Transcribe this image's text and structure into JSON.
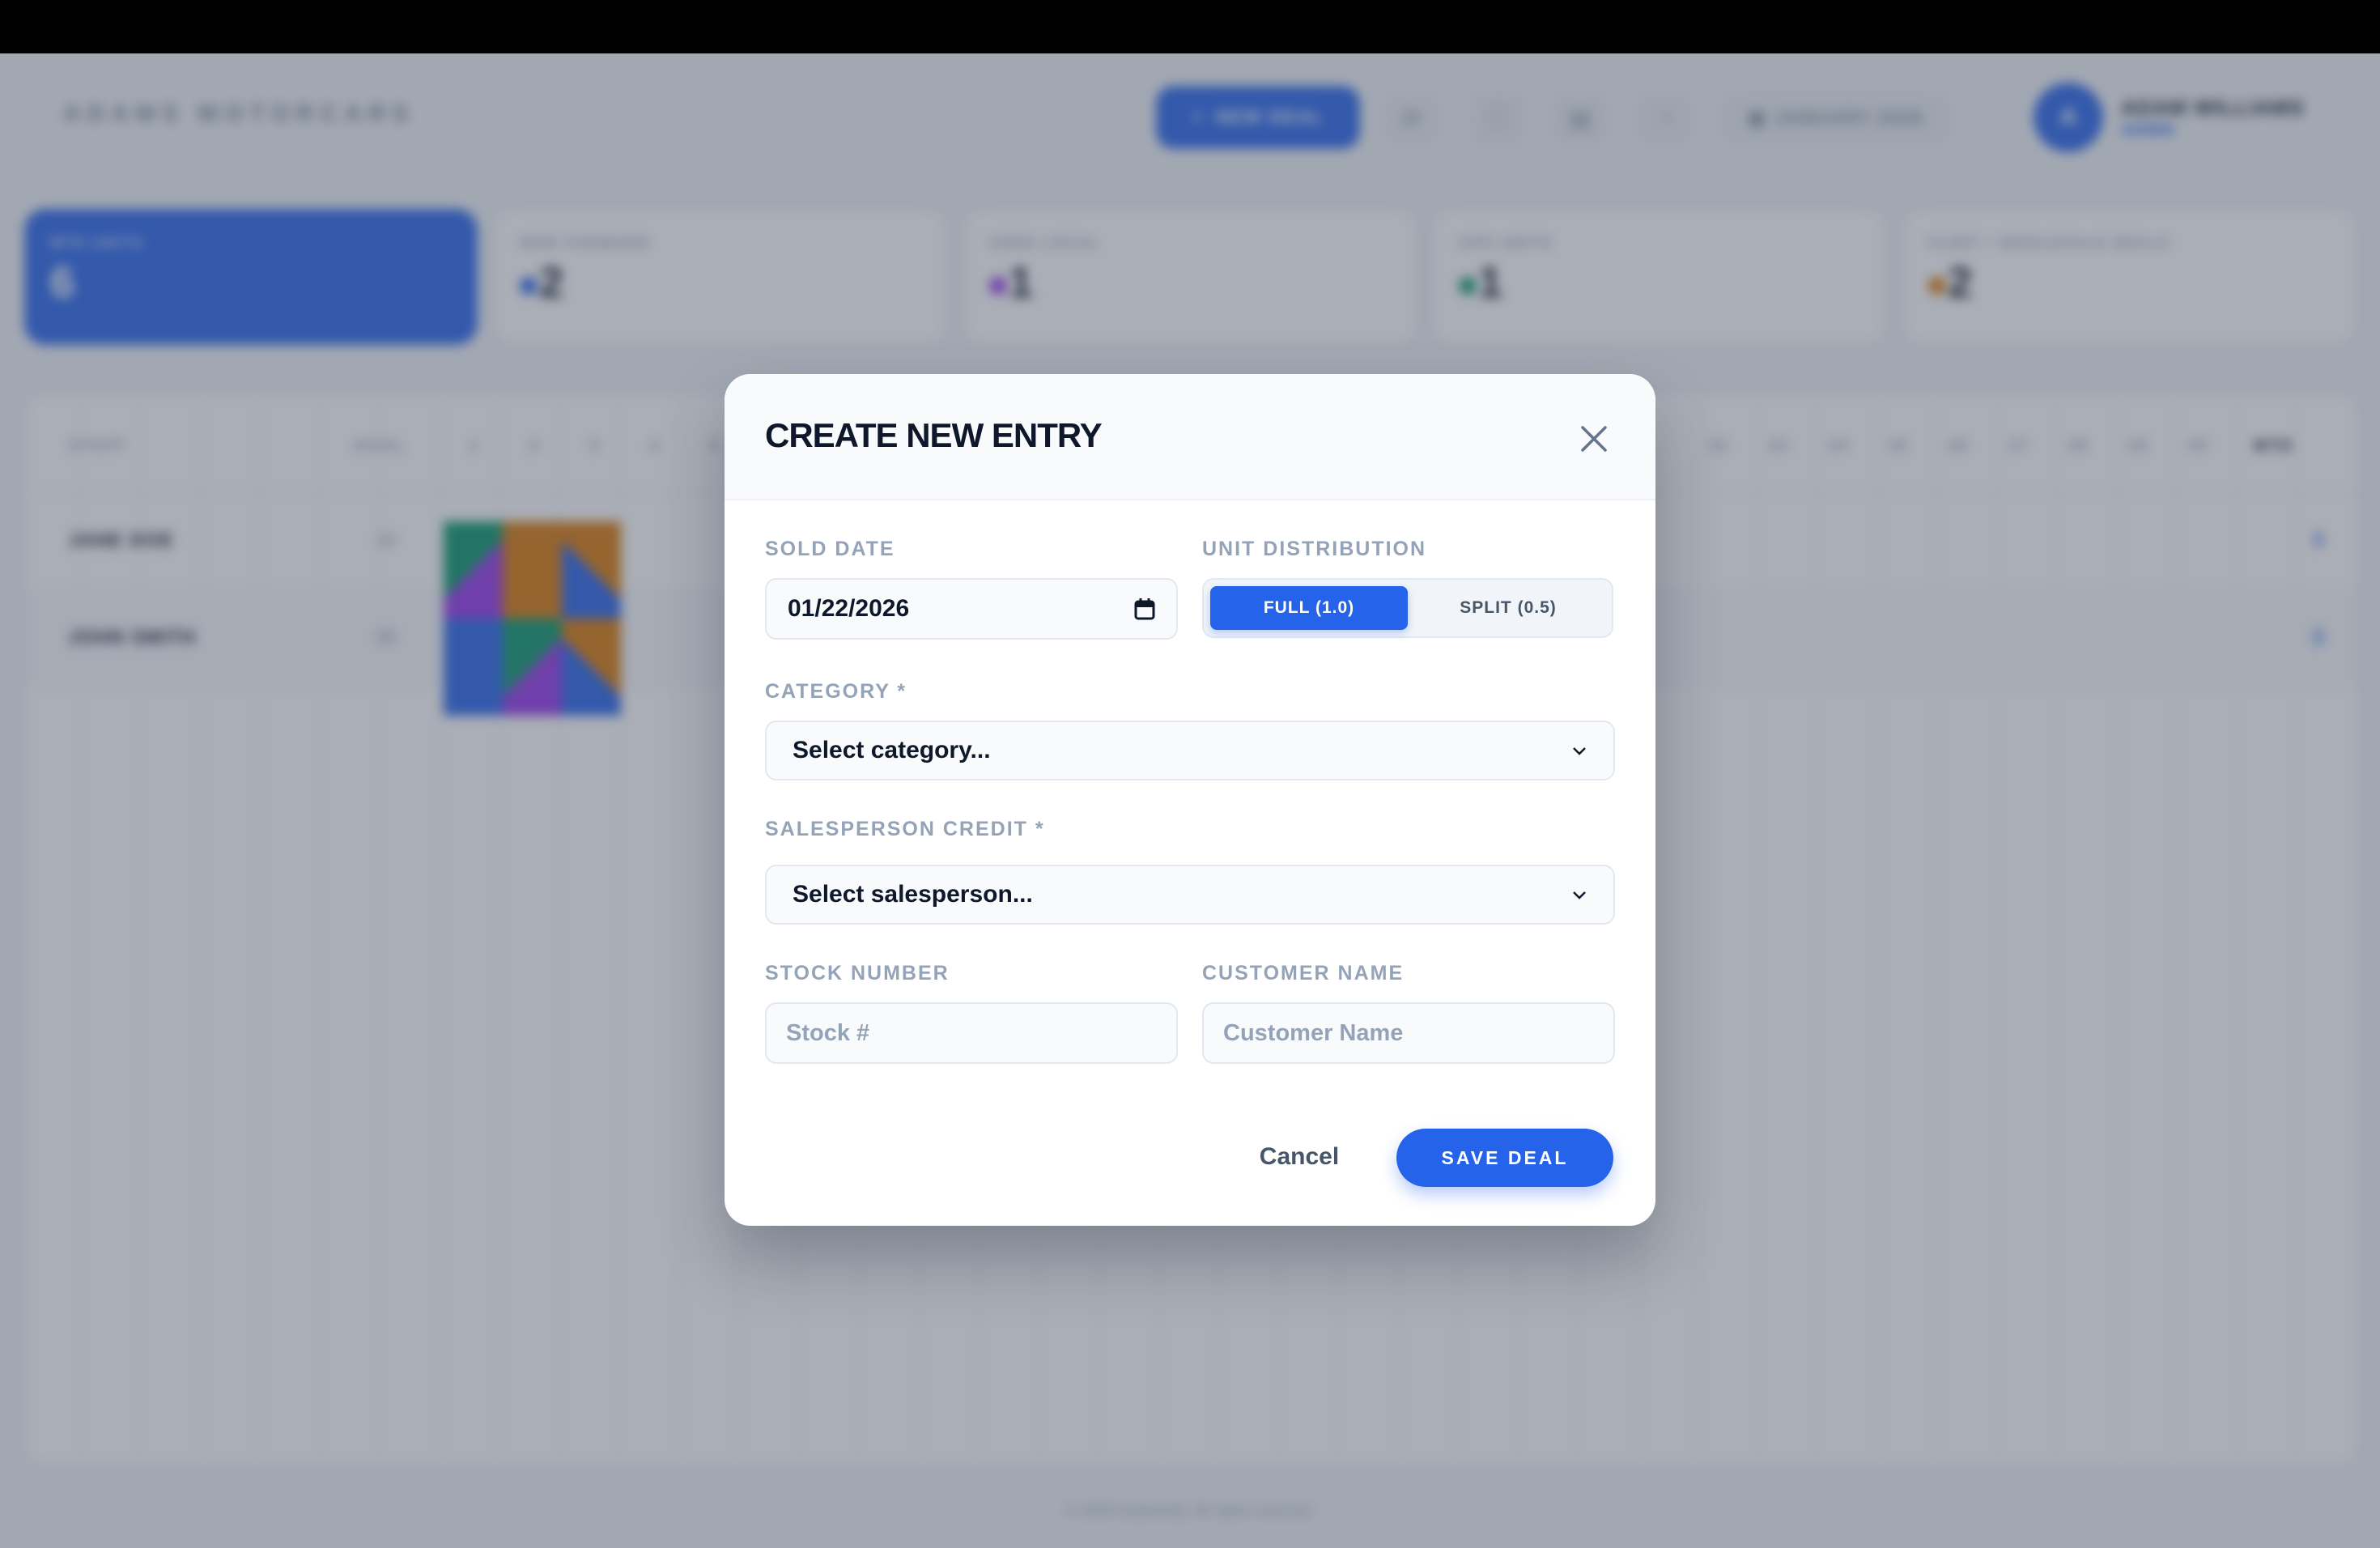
{
  "app": {
    "brand": "ADAMS MOTORCARS",
    "new_deal_label": "NEW DEAL",
    "month_label": "JANUARY 2026",
    "user": {
      "initial": "A",
      "name": "ADAM WILLIAMS",
      "role": "ADMIN"
    },
    "stats": [
      {
        "label": "MTD UNITS",
        "value": "6"
      },
      {
        "label": "NEW FORWARD",
        "value": "2",
        "color": "#2563eb"
      },
      {
        "label": "USED LOCAL",
        "value": "1",
        "color": "#9333ea"
      },
      {
        "label": "CPO UNITS",
        "value": "1",
        "color": "#059669"
      },
      {
        "label": "FLEET / WHOLESALE DEALS",
        "value": "2",
        "color": "#d97706"
      }
    ],
    "board": {
      "col_staff": "STAFF",
      "col_goal": "GOAL",
      "col_mtd": "MTD",
      "days_left": [
        "1",
        "2",
        "3",
        "4",
        "5"
      ],
      "days_right": [
        "22",
        "23",
        "24",
        "25",
        "26",
        "27",
        "28",
        "29",
        "30"
      ],
      "rows": [
        {
          "name": "JANE DOE",
          "goal": "10",
          "mtd": "3"
        },
        {
          "name": "JOHN SMITH",
          "goal": "20",
          "mtd": "3"
        }
      ]
    },
    "footer": "© 2026 Dealership. All rights reserved."
  },
  "modal": {
    "title": "CREATE NEW ENTRY",
    "sold_date": {
      "label": "SOLD DATE",
      "value": "01/22/2026"
    },
    "unit_distribution": {
      "label": "UNIT DISTRIBUTION",
      "full": "FULL (1.0)",
      "split": "SPLIT (0.5)",
      "selected": "full"
    },
    "category": {
      "label": "CATEGORY *",
      "selected": "Select category..."
    },
    "salesperson": {
      "label": "SALESPERSON CREDIT *",
      "selected": "Select salesperson..."
    },
    "stock_number": {
      "label": "STOCK NUMBER",
      "placeholder": "Stock #",
      "value": ""
    },
    "customer_name": {
      "label": "CUSTOMER NAME",
      "placeholder": "Customer Name",
      "value": ""
    },
    "cancel_label": "Cancel",
    "save_label": "SAVE DEAL"
  },
  "colors": {
    "accent": "#2563eb",
    "new": "#2563eb",
    "used": "#9333ea",
    "cpo": "#059669",
    "fleet": "#d97706"
  }
}
